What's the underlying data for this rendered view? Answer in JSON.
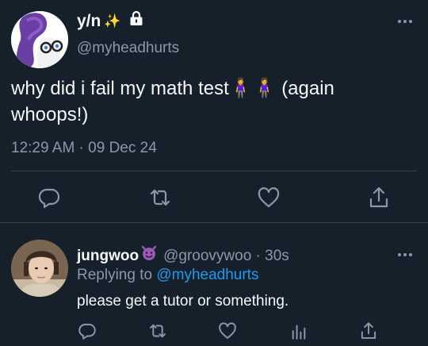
{
  "tweet": {
    "display_name": "y/n",
    "name_emoji": "✨",
    "handle": "@myheadhurts",
    "text": "why did i fail my math test🧍‍♀️🧍‍♀️ (again whoops!)",
    "timestamp": "12:29 AM · 09 Dec 24",
    "actions": [
      "reply-icon",
      "retweet-icon",
      "like-icon",
      "share-icon"
    ]
  },
  "reply": {
    "display_name": "jungwoo",
    "handle": "@groovywoo",
    "separator": " · ",
    "time": "30s",
    "replying_to_prefix": "Replying to ",
    "replying_to_handle": "@myheadhurts",
    "text": "please get a tutor or something.",
    "actions": [
      "reply-icon",
      "retweet-icon",
      "like-icon",
      "analytics-icon",
      "share-icon"
    ]
  },
  "colors": {
    "background": "#15202b",
    "text_primary": "#f7f9f9",
    "text_secondary": "#8b98a5",
    "link": "#1d9bf0",
    "divider": "#38444d"
  }
}
